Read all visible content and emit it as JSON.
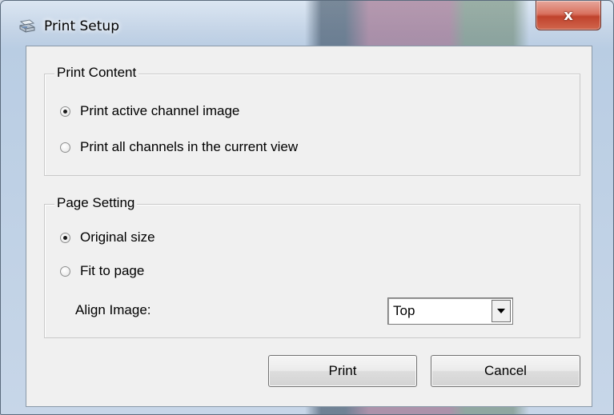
{
  "window": {
    "title": "Print Setup",
    "title_icon": "printer-icon",
    "close_label": "x",
    "accent_close": "#c84a33"
  },
  "print_content": {
    "group_label": "Print Content",
    "options": [
      {
        "label": "Print active channel image",
        "checked": true
      },
      {
        "label": "Print all channels in the current view",
        "checked": false
      }
    ]
  },
  "page_setting": {
    "group_label": "Page Setting",
    "options": [
      {
        "label": "Original size",
        "checked": true
      },
      {
        "label": "Fit to page",
        "checked": false
      }
    ],
    "align_label": "Align Image:",
    "align_value": "Top"
  },
  "buttons": {
    "print_label": "Print",
    "cancel_label": "Cancel"
  }
}
